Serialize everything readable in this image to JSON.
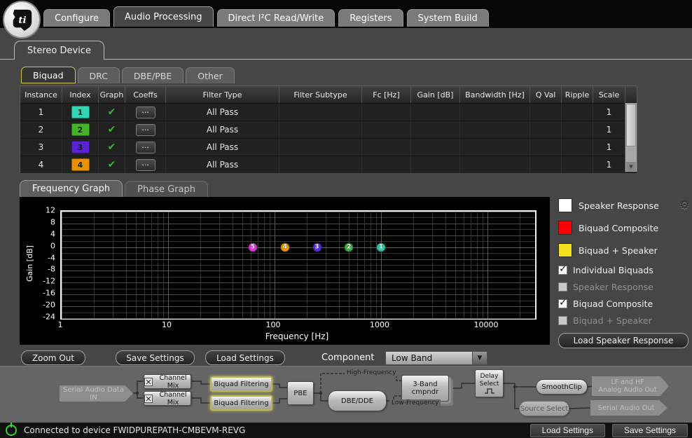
{
  "icons": {
    "gear": "⚙",
    "check": "✔",
    "coeffs": "···",
    "dropdown_arrow": "▼",
    "scroll_down_arrow": "▼"
  },
  "header": {
    "tabs": [
      {
        "label": "Configure"
      },
      {
        "label": "Audio Processing"
      },
      {
        "label": "Direct I²C Read/Write"
      },
      {
        "label": "Registers"
      },
      {
        "label": "System Build"
      }
    ],
    "active_tab": "Audio Processing"
  },
  "device_tab": {
    "label": "Stereo Device"
  },
  "subtabs": {
    "items": [
      {
        "label": "Biquad"
      },
      {
        "label": "DRC"
      },
      {
        "label": "DBE/PBE"
      },
      {
        "label": "Other"
      }
    ],
    "active": "Biquad"
  },
  "biquad_table": {
    "columns": [
      "Instance",
      "Index",
      "Graph",
      "Coeffs",
      "Filter Type",
      "Filter Subtype",
      "Fc [Hz]",
      "Gain [dB]",
      "Bandwidth [Hz]",
      "Q Val",
      "Ripple",
      "Scale"
    ],
    "rows": [
      {
        "instance": "1",
        "index": "1",
        "index_color": "#2fd6b5",
        "graph_enabled": true,
        "filter_type": "All Pass",
        "filter_subtype": "",
        "fc": "",
        "gain": "",
        "bandwidth": "",
        "q": "",
        "ripple": "",
        "scale": "1"
      },
      {
        "instance": "2",
        "index": "2",
        "index_color": "#44b32a",
        "graph_enabled": true,
        "filter_type": "All Pass",
        "filter_subtype": "",
        "fc": "",
        "gain": "",
        "bandwidth": "",
        "q": "",
        "ripple": "",
        "scale": "1"
      },
      {
        "instance": "3",
        "index": "3",
        "index_color": "#5c22d6",
        "graph_enabled": true,
        "filter_type": "All Pass",
        "filter_subtype": "",
        "fc": "",
        "gain": "",
        "bandwidth": "",
        "q": "",
        "ripple": "",
        "scale": "1"
      },
      {
        "instance": "4",
        "index": "4",
        "index_color": "#e89203",
        "graph_enabled": true,
        "filter_type": "All Pass",
        "filter_subtype": "",
        "fc": "",
        "gain": "",
        "bandwidth": "",
        "q": "",
        "ripple": "",
        "scale": "1"
      }
    ]
  },
  "graph_tabs": [
    {
      "label": "Frequency Graph"
    },
    {
      "label": "Phase Graph"
    }
  ],
  "graph_active": "Frequency Graph",
  "chart_data": {
    "type": "line",
    "title": "",
    "xlabel": "Frequency [Hz]",
    "ylabel": "Gain [dB]",
    "x_scale": "log",
    "xlim": [
      1,
      28000
    ],
    "ylim": [
      -24,
      12
    ],
    "y_ticks": [
      12,
      8,
      4,
      0,
      -4,
      -8,
      -12,
      -16,
      -20,
      -24
    ],
    "x_ticks": [
      1,
      10,
      100,
      1000,
      10000
    ],
    "grid": true,
    "grid_minor_db": 2,
    "series": [
      {
        "name": "Biquad Composite",
        "color": "#ff1b1b",
        "x": [
          1,
          28000
        ],
        "y": [
          0,
          0
        ]
      }
    ],
    "biquad_markers": [
      {
        "label": "5",
        "freq": 62.5,
        "gain": 0,
        "color": "#e234e2"
      },
      {
        "label": "4",
        "freq": 125,
        "gain": 0,
        "color": "#ef9303"
      },
      {
        "label": "3",
        "freq": 250,
        "gain": 0,
        "color": "#5b2de8"
      },
      {
        "label": "2",
        "freq": 500,
        "gain": 0,
        "color": "#3fae3f"
      },
      {
        "label": "1",
        "freq": 1000,
        "gain": 0,
        "color": "#2bc9ab"
      }
    ],
    "legend_position": "right"
  },
  "legend": {
    "items": [
      {
        "label": "Speaker Response",
        "color": "#ffffff",
        "has_gear": true
      },
      {
        "label": "Biquad Composite",
        "color": "#fb0000",
        "has_gear": false
      },
      {
        "label": "Biquad + Speaker",
        "color": "#f3e11c",
        "has_gear": false
      }
    ],
    "checkboxes": [
      {
        "label": "Individual Biquads",
        "checked": true,
        "enabled": true
      },
      {
        "label": "Speaker Response",
        "checked": false,
        "enabled": false
      },
      {
        "label": "Biquad Composite",
        "checked": true,
        "enabled": true
      },
      {
        "label": "Biquad + Speaker",
        "checked": false,
        "enabled": false
      }
    ],
    "load_speaker_button": "Load Speaker Response"
  },
  "controls": {
    "zoom_out": "Zoom Out",
    "save_settings": "Save Settings",
    "load_settings": "Load Settings",
    "component_label": "Component",
    "component_value": "Low Band"
  },
  "flow": {
    "serial_in": "Serial Audio Data IN",
    "channel_mix": "Channel Mix",
    "biquad_filtering": "Biquad Filtering",
    "pbe": "PBE",
    "dbe": "DBE/DDE",
    "high_freq": "High-Frequency",
    "low_freq": "Low-Frequency",
    "threeband_line1": "3-Band",
    "threeband_line2": "cmpndr",
    "delay_line1": "Delay",
    "delay_line2": "Select",
    "smoothclip": "SmoothClip",
    "source_select": "Source Select",
    "lf_hf_line1": "LF and HF",
    "lf_hf_line2": "Analog Audio Out",
    "serial_out": "Serial Audio Out"
  },
  "statusbar": {
    "status": "Connected to device FWIDPUREPATH-CMBEVM-REVG",
    "load_settings": "Load Settings",
    "save_settings": "Save Settings"
  }
}
